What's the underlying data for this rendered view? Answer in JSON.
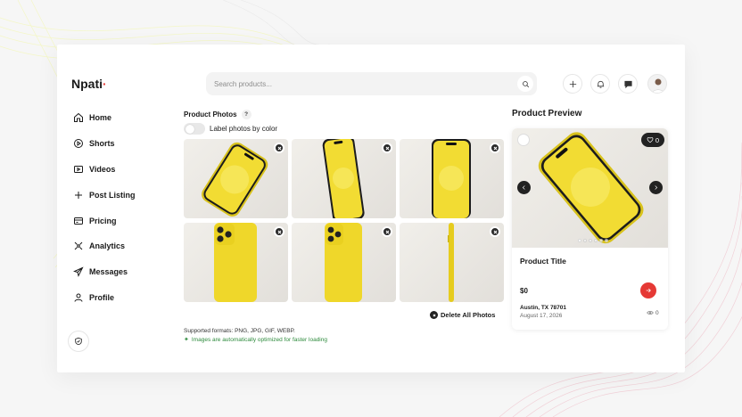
{
  "brand": {
    "name": "Npati",
    "dot": "·"
  },
  "sidebar": {
    "items": [
      {
        "label": "Home",
        "icon": "home-icon"
      },
      {
        "label": "Shorts",
        "icon": "play-circle-icon"
      },
      {
        "label": "Videos",
        "icon": "video-icon"
      },
      {
        "label": "Post Listing",
        "icon": "plus-icon"
      },
      {
        "label": "Pricing",
        "icon": "credit-card-icon"
      },
      {
        "label": "Analytics",
        "icon": "analytics-icon"
      },
      {
        "label": "Messages",
        "icon": "send-icon"
      },
      {
        "label": "Profile",
        "icon": "user-icon"
      }
    ]
  },
  "search": {
    "placeholder": "Search products..."
  },
  "photos": {
    "title": "Product Photos",
    "help": "?",
    "toggle_label": "Label photos by color",
    "delete_all": "Delete All Photos",
    "formats": "Supported formats: PNG, JPG, GIF, WEBP.",
    "optimized": "Images are automatically optimized for faster loading",
    "count": 6
  },
  "preview": {
    "title": "Product Preview",
    "likes": "0",
    "product_title": "Product Title",
    "price": "$0",
    "location": "Austin, TX 78701",
    "date": "August 17, 2026",
    "views": "0"
  },
  "colors": {
    "accent": "#e53935",
    "phone": "#f2dc33",
    "success": "#2e8b3d"
  }
}
